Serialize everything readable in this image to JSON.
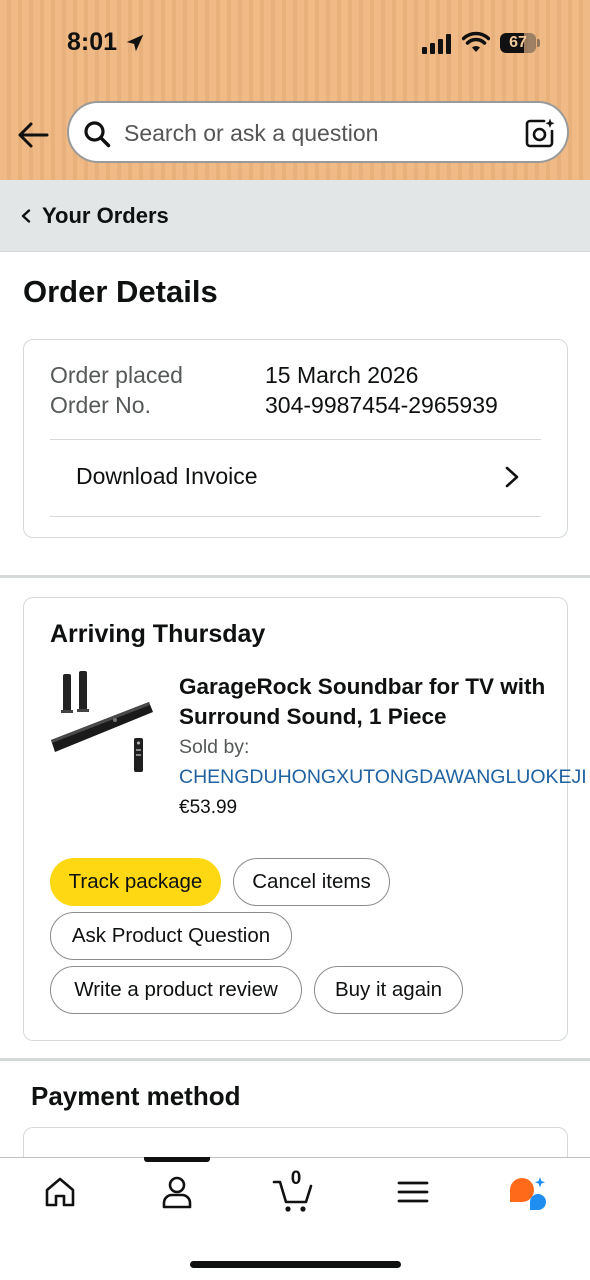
{
  "status_bar": {
    "time": "8:01",
    "battery": "67",
    "battery_level": 0.67
  },
  "search": {
    "placeholder": "Search or ask a question"
  },
  "breadcrumb": {
    "label": "Your Orders"
  },
  "page": {
    "title": "Order Details"
  },
  "order_summary": {
    "placed_label": "Order placed",
    "placed_value": "15 March 2026",
    "number_label": "Order No.",
    "number_value": "304-9987454-2965939",
    "invoice_label": "Download Invoice"
  },
  "shipment": {
    "status": "Arriving Thursday",
    "product_title": "GarageRock Soundbar for TV with Surround Sound, 1 Piece",
    "sold_by_label": "Sold by:",
    "seller": "CHENGDUHONGXUTONGDAWANGLUOKEJI",
    "price": "€53.99",
    "buttons": {
      "track": "Track package",
      "cancel": "Cancel items",
      "ask": "Ask Product Question",
      "review": "Write a product review",
      "buy_again": "Buy it again"
    }
  },
  "payment": {
    "title": "Payment method"
  },
  "bottom_nav": {
    "cart_count": "0",
    "items": [
      "home-icon",
      "account-icon",
      "cart-icon",
      "menu-icon",
      "rufus-icon"
    ]
  },
  "colors": {
    "header_bg": "#efba86",
    "primary_button": "#ffd814",
    "link": "#2162a1",
    "breadcrumb_bg": "#e3e6e6"
  }
}
